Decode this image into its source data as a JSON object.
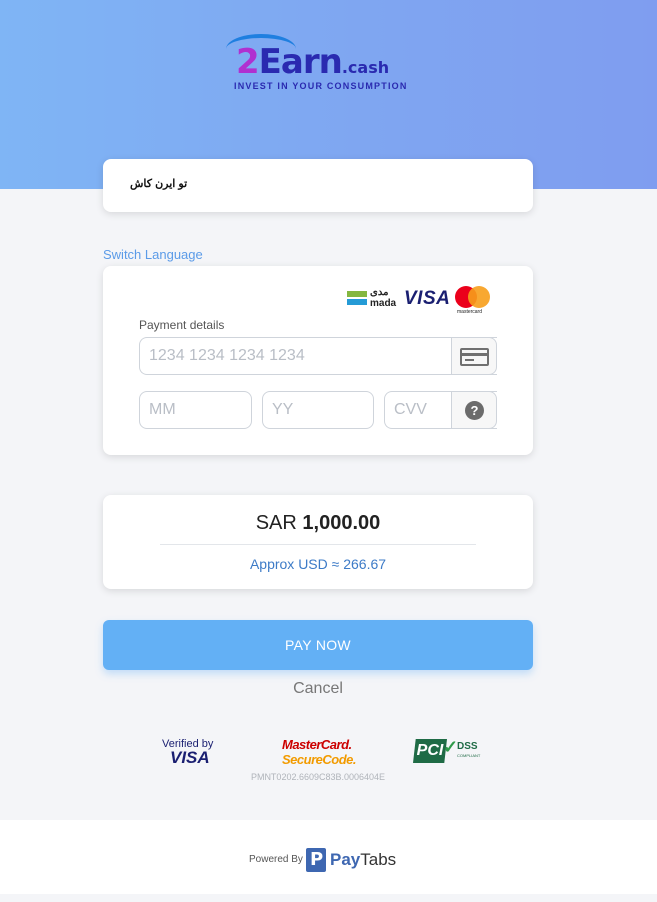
{
  "header": {
    "logo_main": "Earn",
    "logo_two": "2",
    "logo_suffix": ".cash",
    "logo_tagline": "INVEST IN YOUR CONSUMPTION"
  },
  "merchant": {
    "name": "تو ايرن كاش"
  },
  "switch_language": "Switch Language",
  "payment": {
    "card_brands": [
      "mada",
      "VISA",
      "mastercard"
    ],
    "mada_arabic": "مدى",
    "mada_latin": "mada",
    "visa_label": "VISA",
    "mastercard_label": "mastercard",
    "label": "Payment details",
    "card_number_placeholder": "1234 1234 1234 1234",
    "month_placeholder": "MM",
    "year_placeholder": "YY",
    "cvv_placeholder": "CVV",
    "help_symbol": "?"
  },
  "amount": {
    "currency": "SAR",
    "value": "1,000.00",
    "approx": "Approx USD ≈ 266.67"
  },
  "actions": {
    "pay_label": "PAY NOW",
    "cancel_label": "Cancel"
  },
  "trust": {
    "verified_line1": "Verified by",
    "verified_line2": "VISA",
    "mc_line1": "MasterCard.",
    "mc_line2": "SecureCode.",
    "pci_p": "PCI",
    "pci_dss": "DSS",
    "pci_compliant": "COMPLIANT",
    "reference": "PMNT0202.6609C83B.0006404E"
  },
  "footer": {
    "powered_by": "Powered By",
    "brand_pay": "Pay",
    "brand_tabs": "Tabs"
  },
  "colors": {
    "hero_start": "#7fb5f5",
    "hero_end": "#7f9df0",
    "pay_button": "#63b0f5",
    "link": "#5b9be8",
    "approx_text": "#3d7bc7"
  }
}
